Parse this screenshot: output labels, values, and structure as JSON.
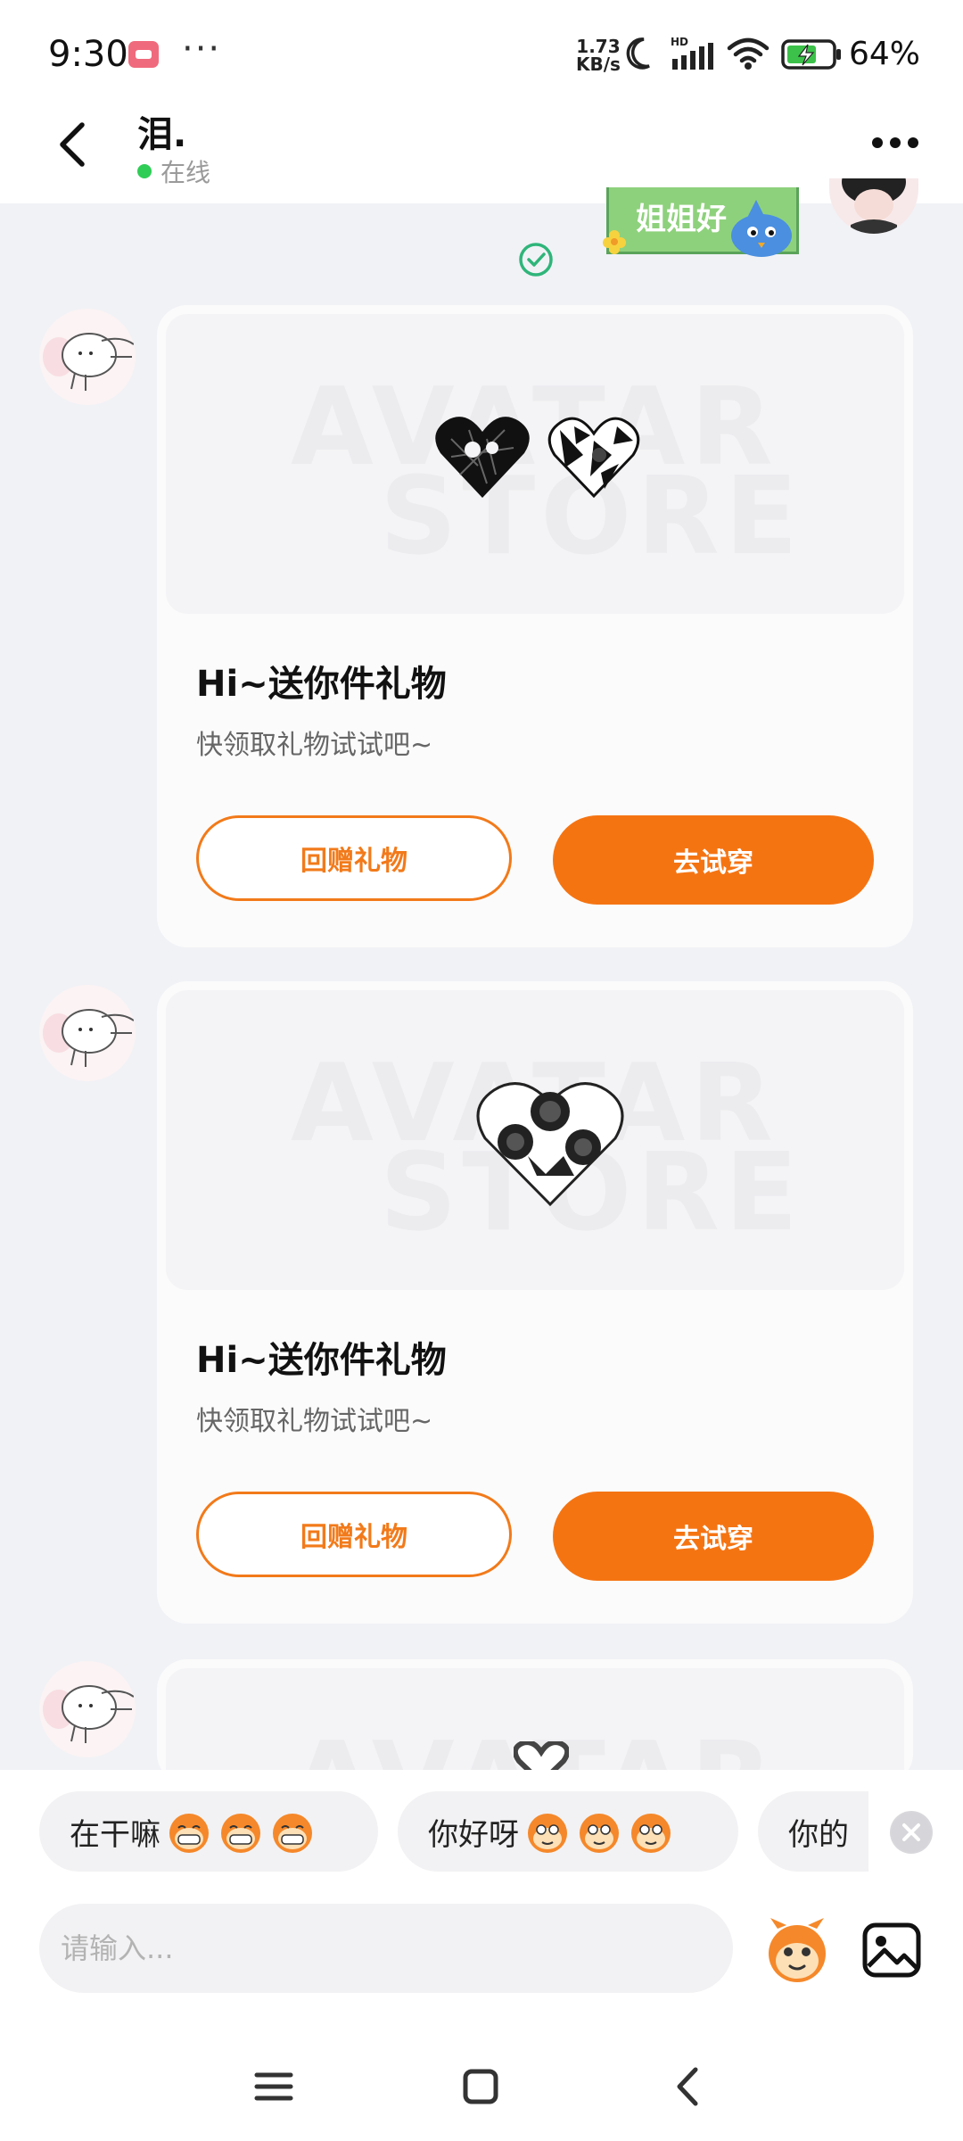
{
  "status_bar": {
    "time": "9:30",
    "more": "···",
    "net_speed_value": "1.73",
    "net_speed_unit": "KB/s",
    "network_badge": "HD",
    "battery_percent": "64%"
  },
  "header": {
    "contact_name": "泪.",
    "status": "在线"
  },
  "sent_sticker_text": "姐姐好",
  "messages": [
    {
      "watermark": [
        "AVATAR",
        "STORE"
      ],
      "title": "Hi~送你件礼物",
      "subtitle": "快领取礼物试试吧~",
      "secondary_button": "回赠礼物",
      "primary_button": "去试穿"
    },
    {
      "watermark": [
        "AVATAR",
        "STORE"
      ],
      "title": "Hi~送你件礼物",
      "subtitle": "快领取礼物试试吧~",
      "secondary_button": "回赠礼物",
      "primary_button": "去试穿"
    }
  ],
  "third_card_watermark": "AVATAR",
  "suggestions": [
    {
      "text": "在干嘛"
    },
    {
      "text": "你好呀"
    },
    {
      "text": "你的"
    }
  ],
  "input": {
    "placeholder": "请输入..."
  },
  "colors": {
    "accent": "#f57412",
    "online": "#2fcd56",
    "background": "#f1f2f6"
  },
  "icons": [
    "back-arrow-icon",
    "more-dots-icon",
    "check-circle-icon",
    "emoji-face-icon",
    "image-icon",
    "menu-icon",
    "home-square-icon",
    "nav-back-icon"
  ]
}
